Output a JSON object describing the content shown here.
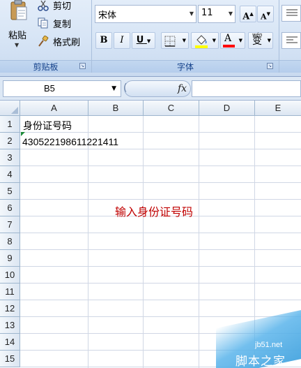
{
  "ribbon": {
    "clipboard": {
      "paste_label": "粘贴",
      "cut_label": "剪切",
      "copy_label": "复制",
      "format_painter_label": "格式刷",
      "group_label": "剪贴板"
    },
    "font": {
      "font_name": "宋体",
      "font_size": "11",
      "grow_label": "A",
      "shrink_label": "A",
      "bold_label": "B",
      "italic_label": "I",
      "underline_label": "U",
      "fontcolor_label": "A",
      "phonetic_top": "wén",
      "phonetic_char": "变",
      "group_label": "字体"
    },
    "colors": {
      "fill_color": "#ffff00",
      "font_color": "#ff0000"
    }
  },
  "formula_bar": {
    "name_box": "B5",
    "fx_label": "fx",
    "formula": ""
  },
  "sheet": {
    "columns": [
      "A",
      "B",
      "C",
      "D",
      "E"
    ],
    "rows": [
      "1",
      "2",
      "3",
      "4",
      "5",
      "6",
      "7",
      "8",
      "9",
      "10",
      "11",
      "12",
      "13",
      "14",
      "15"
    ],
    "cells": {
      "A1": "身份证号码",
      "A2": "430522198611221411"
    }
  },
  "annotation": "输入身份证号码",
  "watermark": {
    "url": "jb51.net",
    "name": "脚本之家"
  }
}
